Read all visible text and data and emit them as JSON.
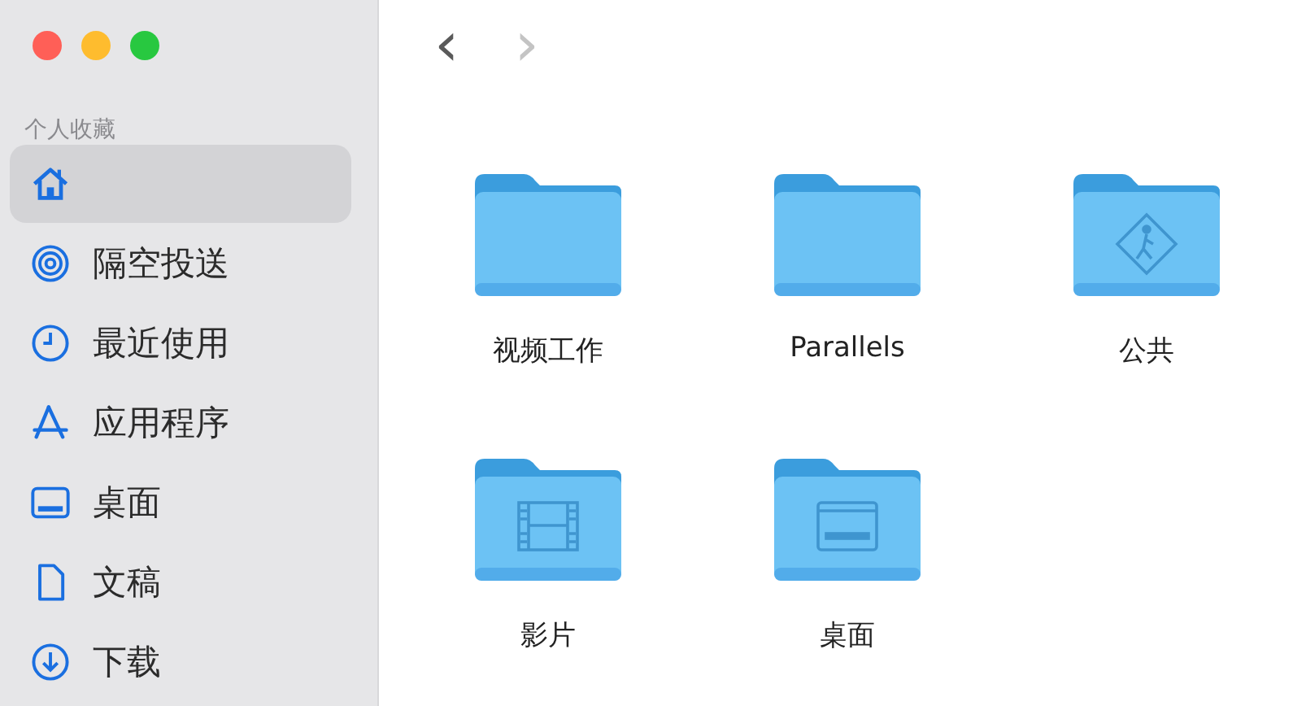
{
  "window": {
    "controls": [
      {
        "color": "#ff5f57"
      },
      {
        "color": "#febc2e"
      },
      {
        "color": "#28c840"
      }
    ]
  },
  "sidebar": {
    "section": "个人收藏",
    "items": [
      {
        "kind": "home",
        "selected": true
      },
      {
        "kind": "airdrop",
        "label": "隔空投送",
        "selected": false
      },
      {
        "kind": "recent",
        "label": "最近使用",
        "selected": false
      },
      {
        "kind": "apps",
        "label": "应用程序",
        "selected": false
      },
      {
        "kind": "desktop",
        "label": "桌面",
        "selected": false
      },
      {
        "kind": "document",
        "label": "文稿",
        "selected": false
      },
      {
        "kind": "download",
        "label": "下载",
        "selected": false
      }
    ]
  },
  "toolbar": {
    "back": {
      "label": "‹",
      "disabled": false
    },
    "forward": {
      "label": "›",
      "disabled": true
    }
  },
  "folders": [
    {
      "name": "视频工作",
      "kind": "plain"
    },
    {
      "name": "Parallels",
      "kind": "plain"
    },
    {
      "name": "公共",
      "kind": "public"
    },
    {
      "name": "影片",
      "kind": "movies"
    },
    {
      "name": "桌面",
      "kind": "desktop"
    }
  ]
}
